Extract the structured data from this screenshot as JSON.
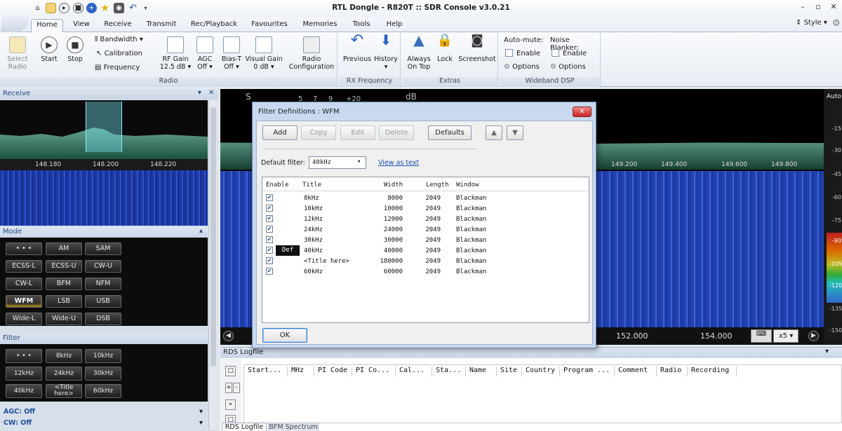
{
  "window": {
    "title": "RTL Dongle - R820T :: SDR Console v3.0.21",
    "style_label": "Style"
  },
  "quick_access": {
    "icons": [
      "home-icon",
      "folder-icon",
      "play-icon",
      "stop-icon",
      "plus-icon",
      "star-icon",
      "camera-icon",
      "undo-icon"
    ]
  },
  "ribbon_tabs": [
    "Home",
    "View",
    "Receive",
    "Transmit",
    "Rec/Playback",
    "Favourites",
    "Memories",
    "Tools",
    "Help"
  ],
  "ribbon": {
    "radio": {
      "select_radio": "Select\nRadio",
      "start": "Start",
      "stop": "Stop",
      "bandwidth": "Bandwidth",
      "calibration": "Calibration",
      "frequency": "Frequency",
      "rf_gain": "RF Gain",
      "rf_gain_val": "12.5 dB",
      "agc": "AGC",
      "agc_val": "Off",
      "bias_t": "Bias-T",
      "bias_t_val": "Off",
      "visual_gain": "Visual Gain",
      "visual_gain_val": "0 dB",
      "radio_config": "Radio\nConfiguration",
      "group": "Radio"
    },
    "rx_frequency": {
      "previous": "Previous",
      "history": "History",
      "group": "RX Frequency"
    },
    "extras": {
      "always_on_top": "Always\nOn Top",
      "lock": "Lock",
      "screenshot": "Screenshot",
      "group": "Extras"
    },
    "wideband": {
      "auto_mute": "Auto-mute:",
      "enable1": "Enable",
      "options1": "Options",
      "noise_blanker": "Noise Blanker:",
      "enable2": "Enable",
      "options2": "Options",
      "group": "Wideband DSP"
    }
  },
  "receive_pane": {
    "title": "Receive",
    "freqs": [
      "148.180",
      "148.200",
      "148.220"
    ]
  },
  "mode_pane": {
    "title": "Mode",
    "buttons": [
      "• • •",
      "AM",
      "SAM",
      "ECSS-L",
      "ECSS-U",
      "CW-U",
      "CW-L",
      "BFM",
      "NFM",
      "WFM",
      "LSB",
      "USB",
      "Wide-L",
      "Wide-U",
      "DSB"
    ],
    "selected": "WFM"
  },
  "filter_pane": {
    "title": "Filter",
    "buttons": [
      "• • •",
      "8kHz",
      "10kHz",
      "12kHz",
      "24kHz",
      "30kHz",
      "40kHz",
      "<Title\nhere>",
      "60kHz"
    ]
  },
  "status": {
    "agc": "AGC: Off",
    "cw": "CW: Off"
  },
  "spectrum": {
    "scale_label": "S",
    "db_label": "dB",
    "top_nums": [
      "5",
      "7",
      "9",
      "+20"
    ],
    "right_freqs": [
      "149.200",
      "149.400",
      "149.600",
      "149.800"
    ],
    "bottom_freqs": [
      "152.000",
      "154.000"
    ],
    "db_ticks": [
      "-15",
      "-30",
      "-45",
      "-60",
      "-75",
      "-90",
      "-105",
      "-120",
      "-135",
      "-150"
    ],
    "auto_label": "Auto",
    "zoom": "x5"
  },
  "dialog": {
    "title": "Filter Definitions : WFM",
    "buttons": {
      "add": "Add",
      "copy": "Copy",
      "edit": "Edit",
      "delete": "Delete",
      "defaults": "Defaults",
      "ok": "OK"
    },
    "default_filter_label": "Default filter:",
    "default_filter_value": "40kHz",
    "view_as_text": "View as text",
    "columns": {
      "enable": "Enable",
      "title": "Title",
      "width": "Width",
      "length": "Length",
      "window": "Window"
    },
    "rows": [
      {
        "def": "",
        "title": "8kHz",
        "width": "8000",
        "length": "2049",
        "window": "Blackman"
      },
      {
        "def": "",
        "title": "10kHz",
        "width": "10000",
        "length": "2049",
        "window": "Blackman"
      },
      {
        "def": "",
        "title": "12kHz",
        "width": "12000",
        "length": "2049",
        "window": "Blackman"
      },
      {
        "def": "",
        "title": "24kHz",
        "width": "24000",
        "length": "2049",
        "window": "Blackman"
      },
      {
        "def": "",
        "title": "30kHz",
        "width": "30000",
        "length": "2049",
        "window": "Blackman"
      },
      {
        "def": "Def",
        "title": "40kHz",
        "width": "40000",
        "length": "2049",
        "window": "Blackman"
      },
      {
        "def": "",
        "title": "<Title here>",
        "width": "180000",
        "length": "2049",
        "window": "Blackman"
      },
      {
        "def": "",
        "title": "60kHz",
        "width": "60000",
        "length": "2049",
        "window": "Blackman"
      }
    ]
  },
  "rds": {
    "title": "RDS Logfile",
    "columns": [
      "Start...",
      "MHz",
      "PI Code",
      "PI Co...",
      "Cal...",
      "Sta...",
      "Name",
      "Site",
      "Country",
      "Program ...",
      "Comment",
      "Radio",
      "Recording"
    ],
    "tabs": [
      "RDS Logfile",
      "BFM Spectrum"
    ]
  },
  "colors": {
    "accent": "#1e4f9c",
    "waterfall": "#2a4fc8",
    "spectrum": "#6fb39a",
    "dialog_frame": "#c7d8ef"
  }
}
